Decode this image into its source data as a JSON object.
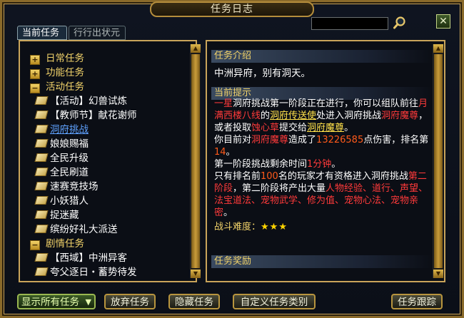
{
  "window": {
    "title": "任务日志",
    "close_glyph": "✕"
  },
  "tabs": [
    {
      "label": "当前任务"
    },
    {
      "label": "行行出状元"
    }
  ],
  "search": {
    "value": "",
    "placeholder": ""
  },
  "tree": {
    "categories": [
      {
        "label": "日常任务",
        "expanded": false,
        "toggle": "+"
      },
      {
        "label": "功能任务",
        "expanded": false,
        "toggle": "+"
      },
      {
        "label": "活动任务",
        "expanded": true,
        "toggle": "−"
      },
      {
        "label": "剧情任务",
        "expanded": true,
        "toggle": "−"
      }
    ],
    "activity_tasks": [
      "【活动】幻兽试炼",
      "【教师节】献花谢师",
      "洞府挑战",
      "娘娘赐福",
      "全民升级",
      "全民刷道",
      "速赛竞技场",
      "小妖猎人",
      "捉迷藏",
      "缤纷好礼大派送"
    ],
    "story_tasks": [
      "【西域】中洲异客",
      "夸父逐日・蓄势待发"
    ],
    "selected": "洞府挑战"
  },
  "detail": {
    "intro_title": "任务介绍",
    "intro_text": "中洲异府，别有洞天。",
    "tips_title": "当前提示",
    "tips": {
      "p1": "一星",
      "p2": "洞府挑战第一阶段正在进行，你可以组队前往",
      "p3": "月满西楼八线",
      "p4": "的",
      "p5": "洞府传送使",
      "p6": "处进入洞府挑战",
      "p7": "洞府魔尊",
      "p8": "，或者投取",
      "p9": "蚀心草",
      "p10": "提交给",
      "p11": "洞府魔尊",
      "p12": "。",
      "p13": "你目前对",
      "p14": "洞府魔尊",
      "p15": "造成了",
      "p16": "13226585",
      "p17": "点伤害，排名第",
      "p18": "14",
      "p19": "。",
      "p20": "第一阶段挑战剩余时间",
      "p21": "1分钟",
      "p22": "。",
      "p23": "只有排名前",
      "p24": "100",
      "p25": "名的玩家才有资格进入洞府挑战",
      "p26": "第二阶段",
      "p27": "，第二阶段将产出大量",
      "p28": "人物经验、道行、声望、法宝道法、宠物武学、修为值、宠物心法、宠物亲密",
      "p29": "。"
    },
    "difficulty_label": "战斗难度：",
    "difficulty_stars": "★★★",
    "reward_title": "任务奖励"
  },
  "buttons": {
    "show_all": "显示所有任务",
    "abandon": "放弃任务",
    "hide": "隐藏任务",
    "custom": "自定义任务类别",
    "track": "任务跟踪"
  },
  "colors": {
    "gold": "#c9a45a",
    "category": "#f2d36a",
    "selected": "#5fa2ff",
    "highlight_red": "#ff3a3a"
  }
}
